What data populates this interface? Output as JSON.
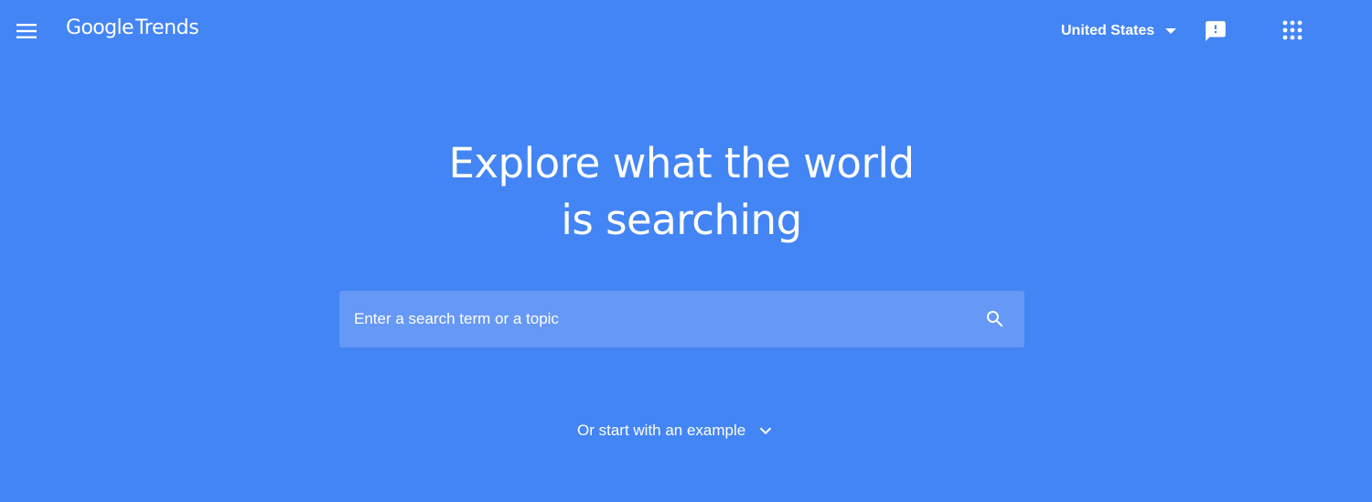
{
  "header": {
    "logo_google": "Google",
    "logo_trends": "Trends",
    "region_label": "United States"
  },
  "hero": {
    "title_line1": "Explore what the world",
    "title_line2": "is searching"
  },
  "search": {
    "placeholder": "Enter a search term or a topic",
    "value": ""
  },
  "examples": {
    "toggle_label": "Or start with an example"
  },
  "icons": {
    "menu": "menu-icon",
    "region_dropdown": "caret-down-icon",
    "feedback": "feedback-icon",
    "apps": "apps-grid-icon",
    "search": "search-icon",
    "example_toggle": "chevron-down-icon"
  },
  "colors": {
    "background": "#4385F4",
    "search_box": "#6698F6",
    "foreground": "#FFFFFF"
  }
}
